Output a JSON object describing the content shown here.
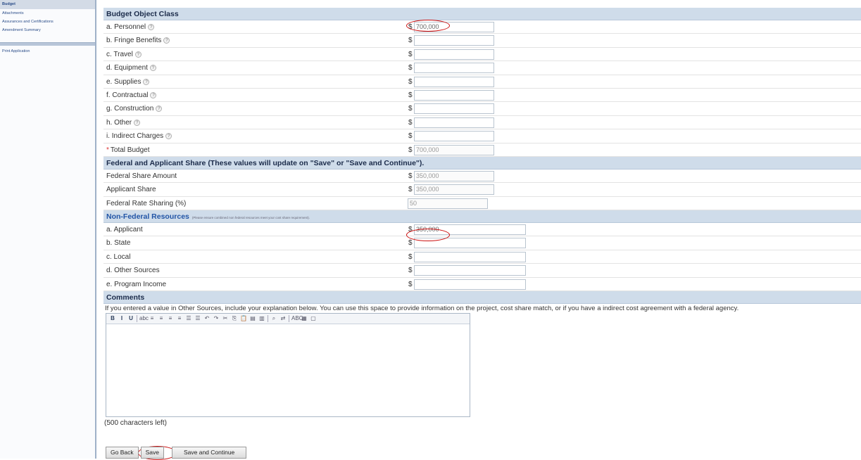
{
  "sidebar": {
    "items": [
      "Budget",
      "Attachments",
      "Assurances and Certifications",
      "Amendment Summary"
    ],
    "print": "Print Application"
  },
  "budget_object_class": {
    "title": "Budget Object Class",
    "currency": "$",
    "rows": [
      {
        "label": "a. Personnel",
        "value": "700,000"
      },
      {
        "label": "b. Fringe Benefits",
        "value": ""
      },
      {
        "label": "c. Travel",
        "value": ""
      },
      {
        "label": "d. Equipment",
        "value": ""
      },
      {
        "label": "e. Supplies",
        "value": ""
      },
      {
        "label": "f. Contractual",
        "value": ""
      },
      {
        "label": "g. Construction",
        "value": ""
      },
      {
        "label": "h. Other",
        "value": ""
      },
      {
        "label": "i. Indirect Charges",
        "value": ""
      }
    ],
    "total_required_mark": "*",
    "total_label": "Total Budget",
    "total_value": "700,000"
  },
  "share": {
    "title": "Federal and Applicant Share (These values will update on \"Save\" or \"Save and Continue\").",
    "federal_label": "Federal Share Amount",
    "federal_value": "350,000",
    "applicant_label": "Applicant Share",
    "applicant_value": "350,000",
    "rate_label": "Federal Rate Sharing (%)",
    "rate_value": "50"
  },
  "non_federal": {
    "title": "Non-Federal Resources",
    "note": "(Please ensure combined non federal resources meet your cost share requirement).",
    "rows": [
      {
        "label": "a. Applicant",
        "value": "350,000"
      },
      {
        "label": "b. State",
        "value": ""
      },
      {
        "label": "c. Local",
        "value": ""
      },
      {
        "label": "d. Other Sources",
        "value": ""
      },
      {
        "label": "e. Program Income",
        "value": ""
      }
    ]
  },
  "comments": {
    "title": "Comments",
    "hint": "If you entered a value in Other Sources, include your explanation below. You can use this space to provide information on the project, cost share match, or if you have a indirect cost agreement with a federal agency.",
    "chars_left": "(500 characters left)",
    "toolbar": [
      "B",
      "I",
      "U",
      "abc",
      "≡",
      "≡",
      "≡",
      "≡",
      "☰",
      "☰",
      "↶",
      "↷",
      "✂",
      "⎘",
      "📋",
      "▤",
      "▥",
      "⌕",
      "⇄",
      "ABC",
      "▦",
      "▢"
    ]
  },
  "buttons": {
    "back": "Go Back",
    "save": "Save",
    "save_continue": "Save and Continue"
  },
  "help_glyph": "?",
  "colors": {
    "section_bg": "#cfdcea",
    "highlight_circle": "#cc1111",
    "sidebar_active": "#d3dbe6"
  }
}
